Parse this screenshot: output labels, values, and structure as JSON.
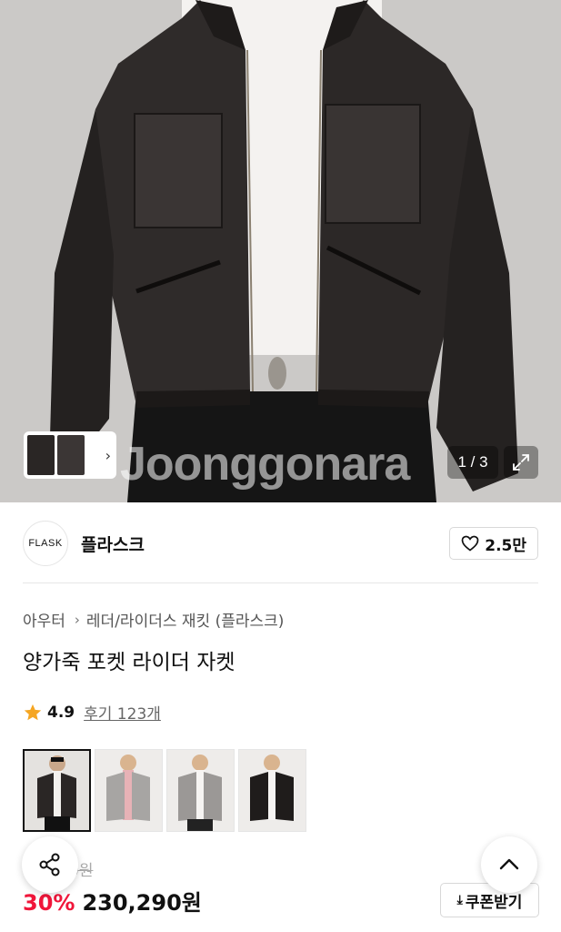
{
  "hero": {
    "watermark": "Joonggonara",
    "pager": "1 / 3",
    "thumb_arrow_icon": "chevron-right-icon",
    "expand_icon": "expand-icon"
  },
  "brand": {
    "logo_text": "FLASK",
    "name": "플라스크",
    "like_icon": "heart-icon",
    "like_count": "2.5만"
  },
  "breadcrumb": {
    "category": "아우터",
    "subcategory": "레더/라이더스 재킷 (플라스크)"
  },
  "product": {
    "title": "양가죽 포켓 라이더 자켓",
    "rating": "4.9",
    "reviews": "후기 123개"
  },
  "colors": {
    "options": [
      "black",
      "gray-pink",
      "gray",
      "black-leather"
    ],
    "selected_index": 0
  },
  "price": {
    "original_fragment": "0원",
    "discount": "30%",
    "final": "230,290원",
    "coupon_label": "쿠폰받기"
  },
  "fabs": {
    "share_icon": "share-icon",
    "top_icon": "chevron-up-icon"
  },
  "colors_hex": {
    "accent_red": "#f0163a",
    "star": "#f5a623"
  }
}
